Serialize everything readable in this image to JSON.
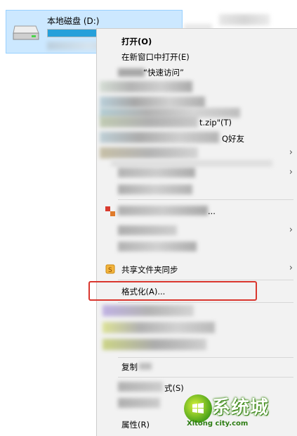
{
  "drive": {
    "name": "本地磁盘 (D:)",
    "usage_fraction": 0.93
  },
  "menu": {
    "open": "打开(O)",
    "open_new_window": "在新窗口中打开(E)",
    "pin_quick_access_suffix": "“快速访问”",
    "zip_suffix": "t.zip\"(T)",
    "friend_suffix": "Q好友",
    "share_sync": "共享文件夹同步",
    "ellipsis_item": "...",
    "format": "格式化(A)...",
    "copy": "复制",
    "shortcut_suffix": "式(S)",
    "properties": "属性(R)"
  },
  "watermark": {
    "brand": "系统城",
    "site": "Xitong city.com"
  },
  "colors": {
    "selection_bg": "#cce8ff",
    "menu_bg": "#f2f2f2",
    "highlight": "#d9362e",
    "usage_bar": "#26a0da"
  }
}
